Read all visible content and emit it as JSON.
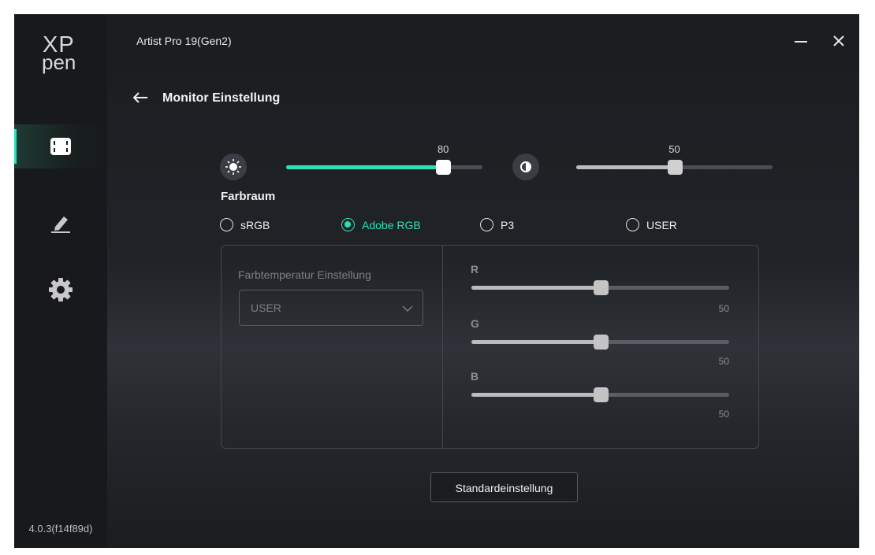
{
  "app": {
    "title": "Artist Pro 19(Gen2)",
    "logo_top": "XP",
    "logo_bottom": "pen",
    "version": "4.0.3(f14f89d)",
    "accent_color": "#2ee0ba"
  },
  "sidebar": {
    "items": [
      {
        "name": "monitor",
        "icon": "screen-frame-icon",
        "active": true
      },
      {
        "name": "pen",
        "icon": "pen-icon",
        "active": false
      },
      {
        "name": "settings",
        "icon": "gear-icon",
        "active": false
      }
    ]
  },
  "window_controls": {
    "minimize_icon": "minimize-icon",
    "close_icon": "close-icon"
  },
  "page": {
    "back_icon": "back-arrow-icon",
    "title": "Monitor Einstellung"
  },
  "brightness": {
    "icon": "sun-icon",
    "value": "80",
    "max": 100
  },
  "contrast": {
    "icon": "contrast-icon",
    "value": "50",
    "max": 100
  },
  "color_space": {
    "label": "Farbraum",
    "options": [
      "sRGB",
      "Adobe RGB",
      "P3",
      "USER"
    ],
    "selected": "Adobe RGB"
  },
  "color_temp": {
    "label": "Farbtemperatur Einstellung",
    "value": "USER",
    "enabled": false
  },
  "rgb": {
    "r": {
      "label": "R",
      "value": "50"
    },
    "g": {
      "label": "G",
      "value": "50"
    },
    "b": {
      "label": "B",
      "value": "50"
    }
  },
  "reset_button": "Standardeinstellung"
}
